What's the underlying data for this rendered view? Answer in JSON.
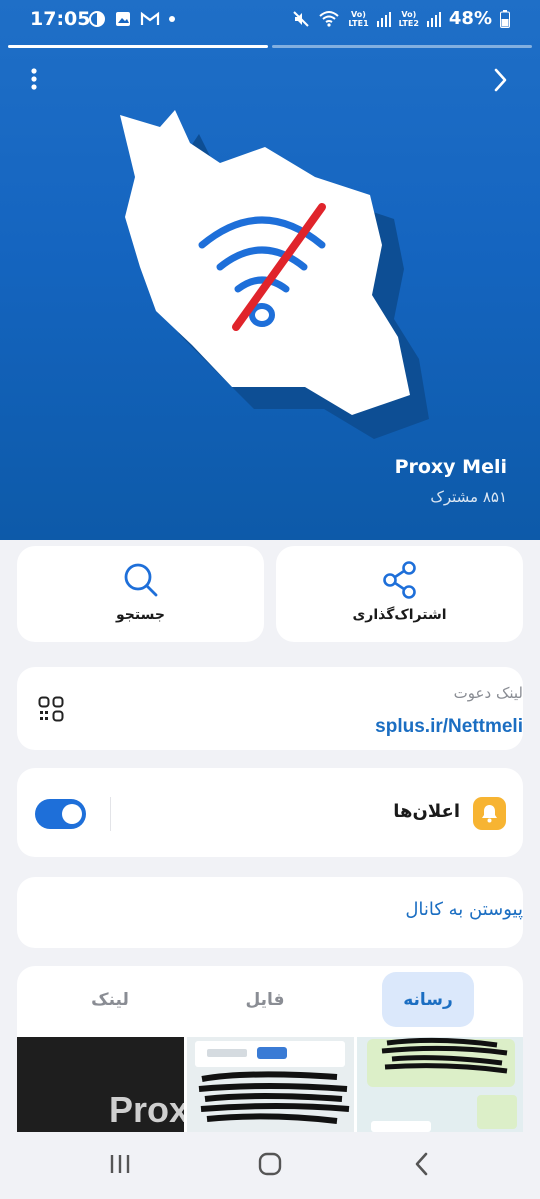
{
  "status_bar": {
    "time": "17:05",
    "battery": "48%",
    "sim1": "LTE1",
    "sim2": "LTE2",
    "volte": "Vo)"
  },
  "channel": {
    "title": "Proxy Meli",
    "subscribers": "۸۵۱ مشترک",
    "story_progress": [
      1.0,
      0.0
    ]
  },
  "actions": {
    "share_label": "اشتراک‌گذاری",
    "search_label": "جستجو"
  },
  "invite": {
    "label": "لینک دعوت",
    "url": "splus.ir/Nettmeli"
  },
  "notifications": {
    "label": "اعلان‌ها",
    "enabled": true
  },
  "join": {
    "label": "پیوستن به کانال"
  },
  "tabs": [
    {
      "label": "رسانه",
      "active": true
    },
    {
      "label": "فایل",
      "active": false
    },
    {
      "label": "لینک",
      "active": false
    }
  ],
  "media": {
    "thumb1_text": "Prox"
  },
  "colors": {
    "hero_blue": "#1565c0",
    "accent": "#1b6ec2",
    "toggle_on": "#1e6fd9",
    "bell_badge": "#f7b432",
    "slash_red": "#e0242b"
  },
  "icons": {
    "more": "more-vert-icon",
    "forward": "chevron-right-icon",
    "share": "share-icon",
    "search": "search-icon",
    "qr": "qr-code-icon",
    "bell": "bell-icon",
    "nav_recent": "recent-apps-icon",
    "nav_home": "home-icon",
    "nav_back": "back-icon"
  }
}
